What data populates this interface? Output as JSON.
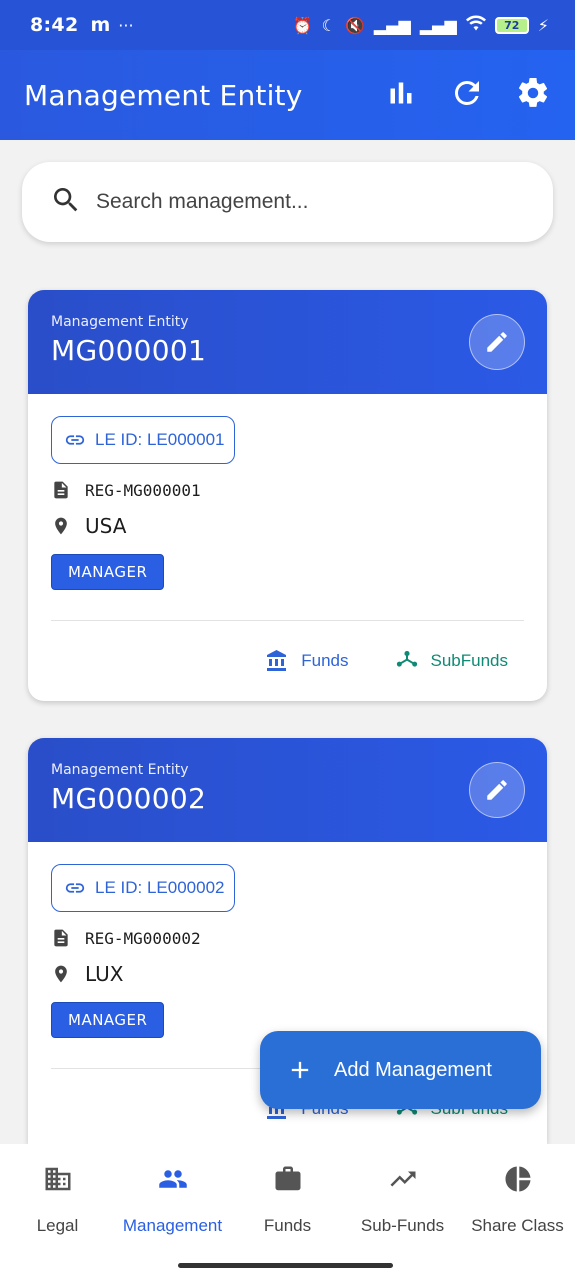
{
  "status": {
    "time": "8:42",
    "m": "m",
    "dots": "···",
    "battery": "72"
  },
  "appbar": {
    "title": "Management Entity"
  },
  "search": {
    "placeholder": "Search management..."
  },
  "cards": [
    {
      "subtitle": "Management Entity",
      "code": "MG000001",
      "le_id": "LE ID: LE000001",
      "reg": "REG-MG000001",
      "location": "USA",
      "badge": "MANAGER",
      "funds_label": "Funds",
      "subfunds_label": "SubFunds"
    },
    {
      "subtitle": "Management Entity",
      "code": "MG000002",
      "le_id": "LE ID: LE000002",
      "reg": "REG-MG000002",
      "location": "LUX",
      "badge": "MANAGER",
      "funds_label": "Funds",
      "subfunds_label": "SubFunds"
    }
  ],
  "fab": {
    "label": "Add Management"
  },
  "nav": [
    {
      "label": "Legal",
      "icon": "building-icon"
    },
    {
      "label": "Management",
      "icon": "people-icon",
      "active": true
    },
    {
      "label": "Funds",
      "icon": "briefcase-icon"
    },
    {
      "label": "Sub-Funds",
      "icon": "trending-up-icon"
    },
    {
      "label": "Share Class",
      "icon": "pie-chart-icon"
    }
  ],
  "colors": {
    "primary": "#2a59df",
    "accent": "#2e64d8",
    "subfunds": "#0f8a75"
  }
}
